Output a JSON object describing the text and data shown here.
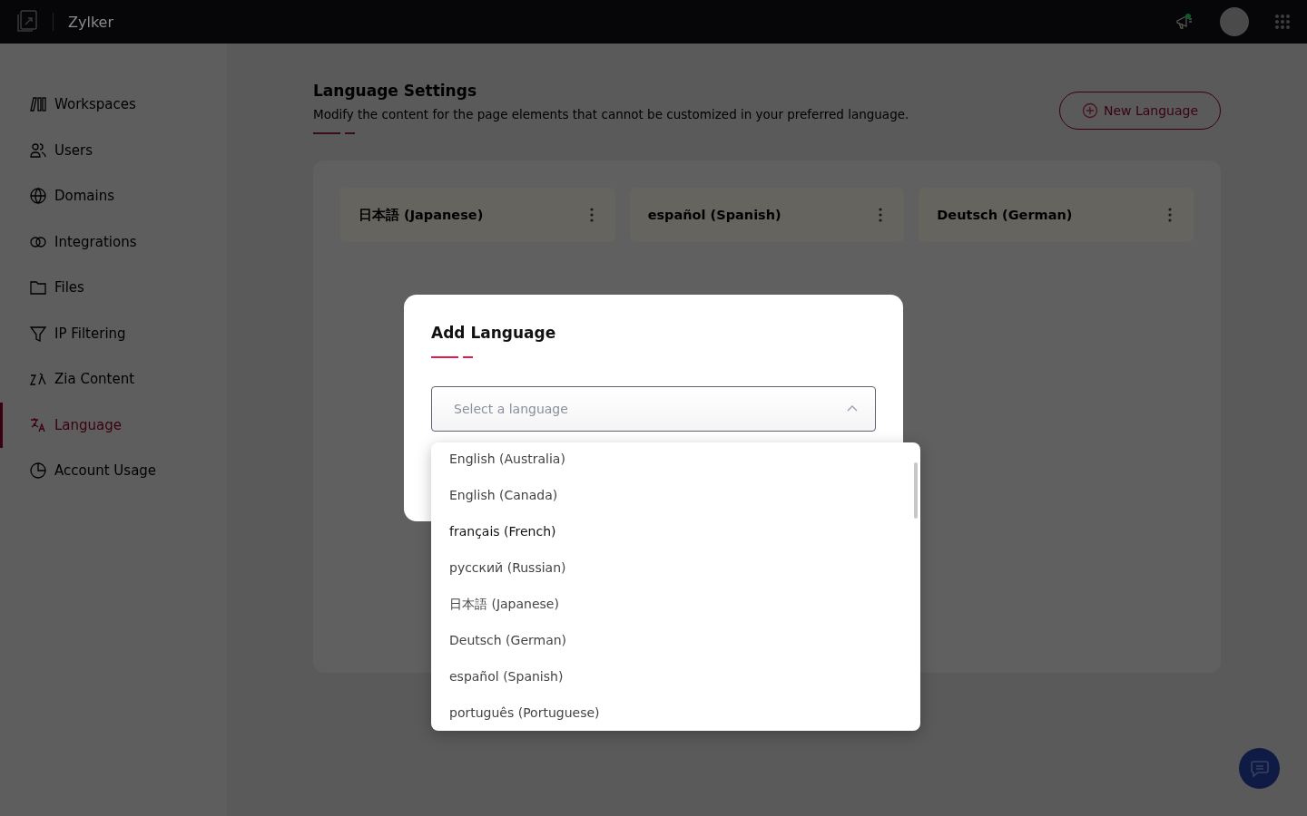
{
  "topbar": {
    "brand": "Zylker"
  },
  "sidebar": {
    "items": [
      {
        "label": "Workspaces",
        "selected": false
      },
      {
        "label": "Users",
        "selected": false
      },
      {
        "label": "Domains",
        "selected": false
      },
      {
        "label": "Integrations",
        "selected": false
      },
      {
        "label": "Files",
        "selected": false
      },
      {
        "label": "IP Filtering",
        "selected": false
      },
      {
        "label": "Zia Content",
        "selected": false
      },
      {
        "label": "Language",
        "selected": true
      },
      {
        "label": "Account Usage",
        "selected": false
      }
    ]
  },
  "header": {
    "title": "Language Settings",
    "description": "Modify the content for the page elements that cannot be customized in your preferred language.",
    "button": "New Language"
  },
  "languages": [
    {
      "name": "日本語 (Japanese)"
    },
    {
      "name": "español (Spanish)"
    },
    {
      "name": "Deutsch (German)"
    }
  ],
  "dialog": {
    "title": "Add Language",
    "select": {
      "placeholder": "Select a language",
      "expanded": true
    },
    "options": [
      {
        "label": "English (Australia)",
        "selected": false
      },
      {
        "label": "English (Canada)",
        "selected": false
      },
      {
        "label": "français (French)",
        "selected": true
      },
      {
        "label": "русский (Russian)",
        "selected": false
      },
      {
        "label": "日本語 (Japanese)",
        "selected": false
      },
      {
        "label": "Deutsch (German)",
        "selected": false
      },
      {
        "label": "español (Spanish)",
        "selected": false
      },
      {
        "label": "português (Portuguese)",
        "selected": false
      }
    ]
  }
}
